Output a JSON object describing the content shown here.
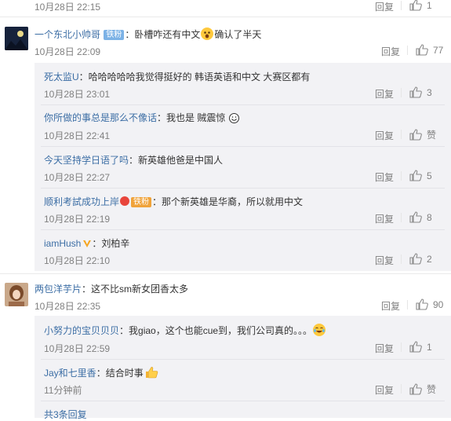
{
  "top_partial": {
    "time": "10月28日 22:15",
    "reply": "回复",
    "likes": "1"
  },
  "comments": [
    {
      "user": "一个东北小帅哥",
      "badge": "铁粉",
      "text_a": "：卧槽咋还有中文",
      "emoji": "fearful-emoji",
      "text_b": "确认了半天",
      "time": "10月28日 22:09",
      "reply": "回复",
      "likes": "77",
      "replies": [
        {
          "user": "死太监U",
          "text": "：哈哈哈哈哈我觉得挺好的 韩语英语和中文 大赛区都有",
          "time": "10月28日 23:01",
          "reply": "回复",
          "likes": "3"
        },
        {
          "user": "你所做的事总是那么不像话",
          "text": "：我也是 贼震惊 ",
          "emoji": "grin-emoji",
          "time": "10月28日 22:41",
          "reply": "回复",
          "likes": "赞"
        },
        {
          "user": "今天坚持学日语了吗",
          "text": "：新英雄他爸是中国人",
          "time": "10月28日 22:27",
          "reply": "回复",
          "likes": "5"
        },
        {
          "user": "顺利考試成功上岸",
          "badge": "铁粉",
          "text": "：那个新英雄是华裔，所以就用中文",
          "time": "10月28日 22:19",
          "reply": "回复",
          "likes": "8"
        },
        {
          "user": "iamHush",
          "text": "：刘柏辛",
          "time": "10月28日 22:10",
          "reply": "回复",
          "likes": "2"
        }
      ]
    },
    {
      "user": "两包洋芋片",
      "text": "：这不比sm新女团香太多",
      "time": "10月28日 22:35",
      "reply": "回复",
      "likes": "90",
      "replies": [
        {
          "user": "小努力的宝贝贝贝",
          "text": "：我giao，这个也能cue到，我们公司真的。。。",
          "emoji": "laugh-cry-emoji",
          "time": "10月28日 22:59",
          "reply": "回复",
          "likes": "1"
        },
        {
          "user": "Jay和七里香",
          "text": "：结合时事",
          "emoji": "thumbs-up-emoji",
          "time": "11分钟前",
          "reply": "回复",
          "likes": "赞"
        }
      ]
    }
  ],
  "more_replies": "共3条回复",
  "colors": {
    "link": "#3c6ea5",
    "muted": "#808080",
    "reply_bg": "#f2f2f5",
    "badge": "#7cb2e6"
  }
}
